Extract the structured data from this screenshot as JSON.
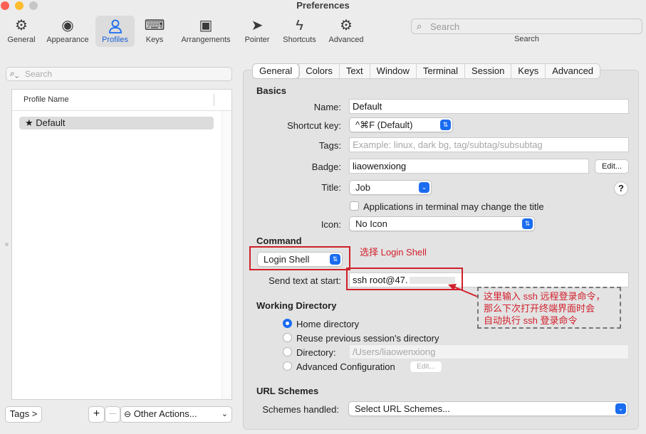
{
  "window": {
    "title": "Preferences"
  },
  "colors": {
    "accent": "#1a6cf0",
    "annotation": "#d21f2b",
    "close": "#fe5f57",
    "minimize": "#febc2e",
    "zoom": "#c7c7c7"
  },
  "toolbar": {
    "items": [
      {
        "label": "General",
        "icon": "gear-icon"
      },
      {
        "label": "Appearance",
        "icon": "eye-icon"
      },
      {
        "label": "Profiles",
        "icon": "person-icon"
      },
      {
        "label": "Keys",
        "icon": "keyboard-icon"
      },
      {
        "label": "Arrangements",
        "icon": "window-icon"
      },
      {
        "label": "Pointer",
        "icon": "cursor-icon"
      },
      {
        "label": "Shortcuts",
        "icon": "bolt-icon"
      },
      {
        "label": "Advanced",
        "icon": "gears-icon"
      }
    ],
    "search_placeholder": "Search",
    "search_label": "Search"
  },
  "left": {
    "search_placeholder": "Search",
    "column_header": "Profile Name",
    "profiles": [
      {
        "name": "Default",
        "star": "★"
      }
    ],
    "tags_button": "Tags >",
    "add_button": "+",
    "remove_button": "—",
    "other_actions": "Other Actions..."
  },
  "tabs": [
    "General",
    "Colors",
    "Text",
    "Window",
    "Terminal",
    "Session",
    "Keys",
    "Advanced"
  ],
  "basics": {
    "heading": "Basics",
    "name_label": "Name:",
    "name_value": "Default",
    "shortcut_label": "Shortcut key:",
    "shortcut_value": "^⌘F (Default)",
    "tags_label": "Tags:",
    "tags_placeholder": "Example: linux, dark bg, tag/subtag/subsubtag",
    "badge_label": "Badge:",
    "badge_value": "liaowenxiong",
    "edit_button": "Edit...",
    "title_label": "Title:",
    "title_value": "Job",
    "help": "?",
    "apps_change_title": "Applications in terminal may change the title",
    "icon_label": "Icon:",
    "icon_value": "No Icon"
  },
  "command": {
    "heading": "Command",
    "mode": "Login Shell",
    "send_text_label": "Send text at start:",
    "send_text_value": "ssh root@47.",
    "annotation_select": "选择 Login Shell",
    "annotation_ssh_1": "这里输入 ssh 远程登录命令，",
    "annotation_ssh_2": "那么下次打开终端界面时会",
    "annotation_ssh_3": "自动执行 ssh 登录命令"
  },
  "working_directory": {
    "heading": "Working Directory",
    "options": [
      {
        "label": "Home directory",
        "selected": true
      },
      {
        "label": "Reuse previous session's directory",
        "selected": false
      },
      {
        "label": "Directory:",
        "selected": false
      },
      {
        "label": "Advanced Configuration",
        "selected": false
      }
    ],
    "directory_placeholder": "/Users/liaowenxiong",
    "edit_button": "Edit..."
  },
  "url_schemes": {
    "heading": "URL Schemes",
    "label": "Schemes handled:",
    "value": "Select URL Schemes..."
  }
}
